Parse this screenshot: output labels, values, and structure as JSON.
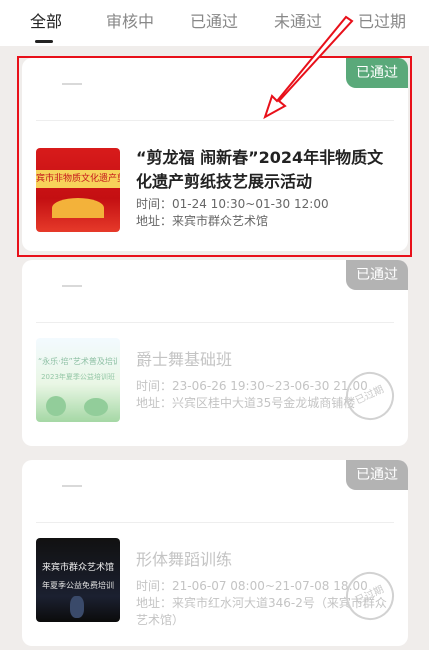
{
  "tabs": [
    "全部",
    "审核中",
    "已通过",
    "未通过",
    "已过期"
  ],
  "cards": [
    {
      "status": "已通过",
      "title": "“剪龙福 闹新春”2024年非物质文化遗产剪纸技艺展示活动",
      "time": "时间：01-24 10:30~01-30 12:00",
      "address": "地址：来宾市群众艺术馆",
      "thumb_text": "宾市非物质文化遗产剪纸技"
    },
    {
      "status": "已通过",
      "title": "爵士舞基础班",
      "time": "时间：23-06-26 19:30~23-06-30 21:00",
      "address": "地址：兴宾区桂中大道35号金龙城商铺楼",
      "thumb_text": "“永乐·培”艺术普及培训",
      "thumb_sub": "2023年夏季公益培训班",
      "stamp": "已过期"
    },
    {
      "status": "已通过",
      "title": "形体舞蹈训练",
      "time": "时间：21-06-07 08:00~21-07-08 18:00",
      "address": "地址：来宾市红水河大道346-2号（来宾市群众艺术馆）",
      "thumb_text": "来宾市群众艺术馆",
      "thumb_sub": "年夏季公益免费培训",
      "stamp": "已过期"
    }
  ],
  "colors": {
    "accent_red": "#e8101a",
    "pass_green": "#5aa97a"
  }
}
